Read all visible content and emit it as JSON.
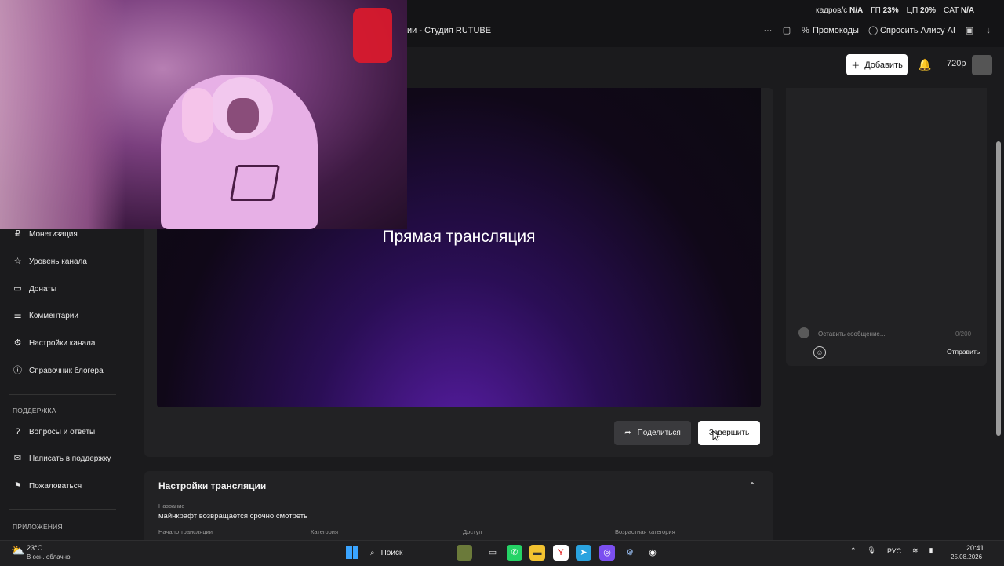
{
  "browser": {
    "tab_title": "ии - Студия RUTUBE",
    "promo": "Промокоды",
    "alice": "Спросить Алису AI",
    "stats": {
      "fps_label": "кадров/с",
      "fps_value": "N/A",
      "gpu_label": "ГП",
      "gpu_value": "23%",
      "cpu_label": "ЦП",
      "cpu_value": "20%",
      "sat_label": "CAT",
      "sat_value": "N/A"
    }
  },
  "header": {
    "add_label": "Добавить",
    "quality": "720p"
  },
  "sidebar": {
    "items": [
      {
        "label": "Монетизация",
        "icon": "ruble-icon"
      },
      {
        "label": "Уровень канала",
        "icon": "star-icon"
      },
      {
        "label": "Донаты",
        "icon": "wallet-icon"
      },
      {
        "label": "Комментарии",
        "icon": "comment-icon"
      },
      {
        "label": "Настройки канала",
        "icon": "gear-icon"
      },
      {
        "label": "Справочник блогера",
        "icon": "info-icon"
      }
    ],
    "support_section": "ПОДДЕРЖКА",
    "support_items": [
      {
        "label": "Вопросы и ответы",
        "icon": "question-icon"
      },
      {
        "label": "Написать в поддержку",
        "icon": "chat-icon"
      },
      {
        "label": "Пожаловаться",
        "icon": "flag-icon"
      }
    ],
    "apps_section": "ПРИЛОЖЕНИЯ"
  },
  "player": {
    "title": "Прямая трансляция"
  },
  "actions": {
    "share": "Поделиться",
    "finish": "Завершить"
  },
  "settings": {
    "title": "Настройки трансляции",
    "name_label": "Название",
    "name_value": "майнкрафт возвращается срочно смотреть",
    "start_label": "Начало трансляции",
    "category_label": "Категория",
    "access_label": "Доступ",
    "age_label": "Возрастная категория"
  },
  "chat": {
    "placeholder": "Оставить сообщение...",
    "count": "0/200",
    "send": "Отправить"
  },
  "taskbar": {
    "temp": "23°C",
    "weather": "В осн. облачно",
    "search": "Поиск",
    "lang": "РУС",
    "time": "20:41",
    "date": "25.08.2026"
  }
}
